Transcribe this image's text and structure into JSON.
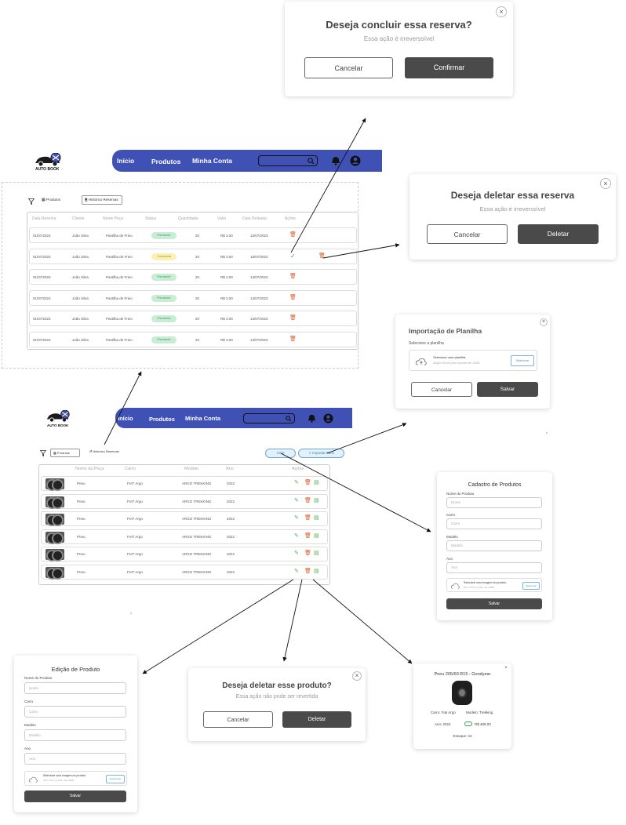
{
  "modal_concluir": {
    "title": "Deseja concluir essa reserva?",
    "subtitle": "Essa ação é irreverssível",
    "cancel": "Cancelar",
    "confirm": "Confirmar",
    "close": "×"
  },
  "modal_deletar_reserva": {
    "title": "Deseja deletar essa reserva",
    "subtitle": "Essa ação é irreverssível",
    "cancel": "Cancelar",
    "confirm": "Deletar",
    "close": "×"
  },
  "navbar": {
    "logo": "AUTO BOOK",
    "inicio": "Início",
    "produtos": "Produtos",
    "minha_conta": "Minha Conta"
  },
  "reservas": {
    "filter_tab": "Produtos",
    "active_tab": "Histórico Reservas",
    "headers": [
      "Data Reserva",
      "Cliente",
      "Nome Peça",
      "Status",
      "Quantidade",
      "Valor",
      "Data Retirada",
      "Ações"
    ],
    "rows": [
      {
        "date": "01/07/2023",
        "client": "João Silva",
        "part": "Pastilha de Freio",
        "status": "Pendente",
        "qty": "20",
        "value": "R$ 3.00",
        "pickup": "13/07/2023",
        "status_color": "green"
      },
      {
        "date": "01/07/2023",
        "client": "João Silva",
        "part": "Pastilha de Freio",
        "status": "Concluída",
        "qty": "20",
        "value": "R$ 3.00",
        "pickup": "15/07/2023",
        "status_color": "yellow"
      },
      {
        "date": "01/07/2023",
        "client": "João Silva",
        "part": "Pastilha de Freio",
        "status": "Pendente",
        "qty": "20",
        "value": "R$ 3.00",
        "pickup": "13/07/2023",
        "status_color": "green"
      },
      {
        "date": "01/07/2023",
        "client": "João Silva",
        "part": "Pastilha de Freio",
        "status": "Pendente",
        "qty": "20",
        "value": "R$ 3.00",
        "pickup": "13/07/2023",
        "status_color": "green"
      },
      {
        "date": "01/07/2023",
        "client": "João Silva",
        "part": "Pastilha de Freio",
        "status": "Pendente",
        "qty": "20",
        "value": "R$ 3.00",
        "pickup": "13/07/2023",
        "status_color": "green"
      },
      {
        "date": "01/07/2023",
        "client": "João Silva",
        "part": "Pastilha de Freio",
        "status": "Pendente",
        "qty": "20",
        "value": "R$ 3.00",
        "pickup": "13/07/2023",
        "status_color": "green"
      }
    ]
  },
  "importacao": {
    "title": "Importação de Planilha",
    "label": "Selecione a planilha",
    "upload_title": "Selecione uma planilha",
    "upload_hint": "Arquivo Excel para importar até 10MB",
    "upload_button": "Selecionar",
    "cancel": "Cancelar",
    "save": "Salvar",
    "close": "×"
  },
  "produtos": {
    "tab_produtos": "Produtos",
    "tab_historico": "Histórico Reservas",
    "btn_criar": "Criar",
    "btn_importar": "Importar Itens",
    "headers": [
      "Nome da Peça",
      "Carro",
      "Modelo",
      "Ano",
      "Ações"
    ],
    "rows": [
      {
        "name": "Pneu",
        "car": "FIAT Argo",
        "model": "ARGO TREKKING",
        "year": "2022"
      },
      {
        "name": "Pneu",
        "car": "FIAT Argo",
        "model": "ARGO TREKKING",
        "year": "2022"
      },
      {
        "name": "Pneu",
        "car": "FIAT Argo",
        "model": "ARGO TREKKING",
        "year": "2022"
      },
      {
        "name": "Pneu",
        "car": "FIAT Argo",
        "model": "ARGO TREKKING",
        "year": "2022"
      },
      {
        "name": "Pneu",
        "car": "FIAT Argo",
        "model": "ARGO TREKKING",
        "year": "2022"
      },
      {
        "name": "Pneu",
        "car": "FIAT Argo",
        "model": "ARGO TREKKING",
        "year": "2022"
      }
    ]
  },
  "cadastro": {
    "title": "Cadastro de Produtos",
    "f1_label": "Nome do Produto",
    "f1_ph": "Nome",
    "f2_label": "Carro",
    "f2_ph": "Carro",
    "f3_label": "Modelo",
    "f3_ph": "Modelo",
    "f4_label": "Ano",
    "f4_ph": "Ano",
    "upload_title": "Selecione uma imagem do produto",
    "upload_hint": "JPG, PNG ou PDF, até 10MB",
    "upload_button": "Selecionar",
    "save": "Salvar"
  },
  "edicao": {
    "title": "Edição de Produto",
    "f1_label": "Nome do Produto",
    "f1_ph": "Nome",
    "f2_label": "Carro",
    "f2_ph": "Carro",
    "f3_label": "Modelo",
    "f3_ph": "Modelo",
    "f4_label": "Ano",
    "f4_ph": "Ano",
    "upload_title": "Selecione uma imagem do produto",
    "upload_hint": "JPG, PNG ou PDF, até 10MB",
    "upload_button": "Selecionar",
    "save": "Salvar"
  },
  "deletar_produto": {
    "title": "Deseja deletar esse produto?",
    "subtitle": "Essa ação não pode ser revertida",
    "cancel": "Cancelar",
    "confirm": "Deletar",
    "close": "×"
  },
  "detalhe": {
    "title": "Pneu 205/60 R15 - Goodyear",
    "carro": "Carro: Fiat Argo",
    "modelo": "Modelo: Trekking",
    "ano": "Ano: 2022",
    "preco": "R$ 489,00",
    "estoque": "Estoque: 24",
    "close": "×"
  },
  "stray_close": "×",
  "colors": {
    "navbar": "#3f51b5",
    "dark_button": "#4a4a4a",
    "pending": "#c8ecd4",
    "done": "#fbf0b5",
    "delete": "#e05a2b"
  }
}
